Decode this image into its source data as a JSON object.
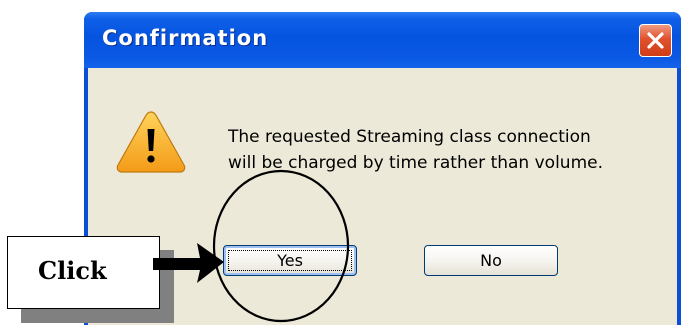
{
  "dialog": {
    "title": "Confirmation",
    "message_line1": "The requested Streaming class connection",
    "message_line2": "will be charged by time rather than volume.",
    "yes_label": "Yes",
    "no_label": "No",
    "icon": "warning-icon",
    "close_icon": "close-icon"
  },
  "annotation": {
    "click_label": "Click",
    "arrow_icon": "arrow-right-icon",
    "highlight": "circle-highlight"
  },
  "colors": {
    "titlebar": "#0554e0",
    "client_bg": "#ece9d8",
    "close_button": "#d8482a",
    "warning": "#f5a623"
  }
}
